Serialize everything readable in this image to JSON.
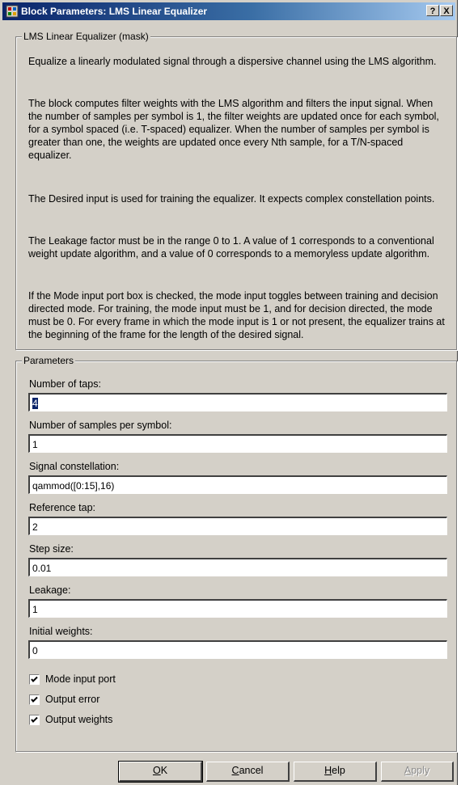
{
  "window": {
    "title": "Block Parameters: LMS Linear  Equalizer",
    "help_label": "?",
    "close_label": "X"
  },
  "mask": {
    "title": "LMS Linear Equalizer (mask)",
    "paragraphs": [
      "Equalize a linearly modulated signal through a dispersive channel using the LMS algorithm.",
      "The block computes filter weights with the LMS algorithm and filters the input signal. When the number of samples per symbol is 1, the filter weights are updated once for each symbol, for a symbol spaced (i.e. T-spaced) equalizer. When the number of samples per symbol is greater than one, the weights are updated once every Nth sample, for a T/N-spaced equalizer.",
      "The Desired input is used for training the equalizer. It expects complex constellation points.",
      "The Leakage factor must be in the range 0 to 1.  A value of 1 corresponds to a conventional weight update algorithm, and a value of 0 corresponds to a memoryless update algorithm.",
      "If the Mode input port box is checked, the mode input toggles between training and decision directed mode. For training, the mode input must be 1, and for decision directed, the mode must be 0. For every frame in which the mode input is 1 or not present, the equalizer trains at the beginning of the frame for the length of the desired signal."
    ]
  },
  "parameters": {
    "title": "Parameters",
    "fields": [
      {
        "label": "Number of taps:",
        "value": "4"
      },
      {
        "label": "Number of samples per symbol:",
        "value": "1"
      },
      {
        "label": "Signal constellation:",
        "value": "qammod([0:15],16)"
      },
      {
        "label": "Reference tap:",
        "value": "2"
      },
      {
        "label": "Step size:",
        "value": "0.01"
      },
      {
        "label": "Leakage:",
        "value": "1"
      },
      {
        "label": "Initial weights:",
        "value": "0"
      }
    ],
    "checkboxes": [
      {
        "label": "Mode input port",
        "checked": true
      },
      {
        "label": "Output error",
        "checked": true
      },
      {
        "label": "Output weights",
        "checked": true
      }
    ]
  },
  "buttons": {
    "ok_label": "OK",
    "ok_accel": "O",
    "ok_rest": "K",
    "cancel_accel": "C",
    "cancel_rest": "ancel",
    "help_accel": "H",
    "help_rest": "elp",
    "apply_accel": "A",
    "apply_rest": "pply"
  },
  "colors": {
    "dialog_face": "#d4d0c8",
    "titlebar_start": "#0a246a",
    "titlebar_end": "#a6caf0",
    "selection": "#0a246a"
  }
}
